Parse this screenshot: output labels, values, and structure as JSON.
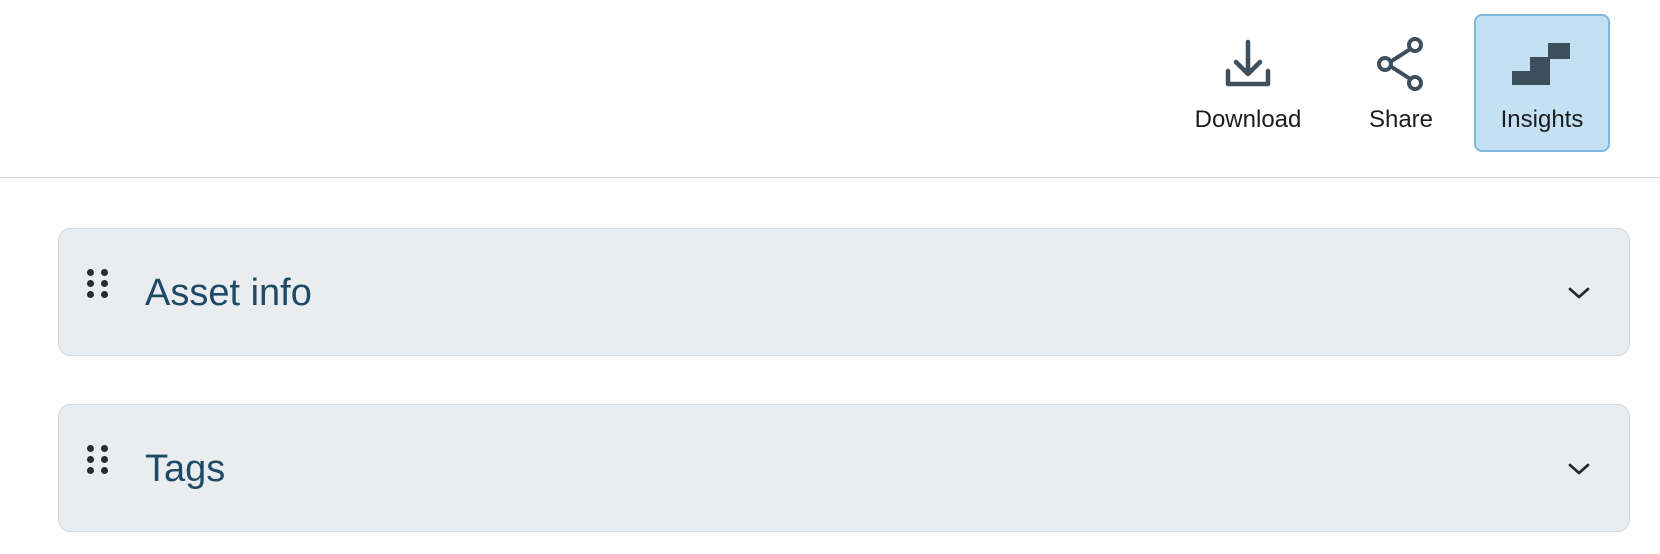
{
  "toolbar": {
    "download": {
      "label": "Download",
      "icon": "download-icon"
    },
    "share": {
      "label": "Share",
      "icon": "share-icon"
    },
    "insights": {
      "label": "Insights",
      "icon": "insights-icon",
      "active": true
    }
  },
  "panels": [
    {
      "title": "Asset info",
      "expanded": false
    },
    {
      "title": "Tags",
      "expanded": false
    }
  ],
  "colors": {
    "active_button_bg": "#c3e1f3",
    "active_button_border": "#7db8df",
    "panel_bg": "#e9edf0",
    "panel_title": "#1f4a66",
    "icon": "#3d4f5c"
  }
}
